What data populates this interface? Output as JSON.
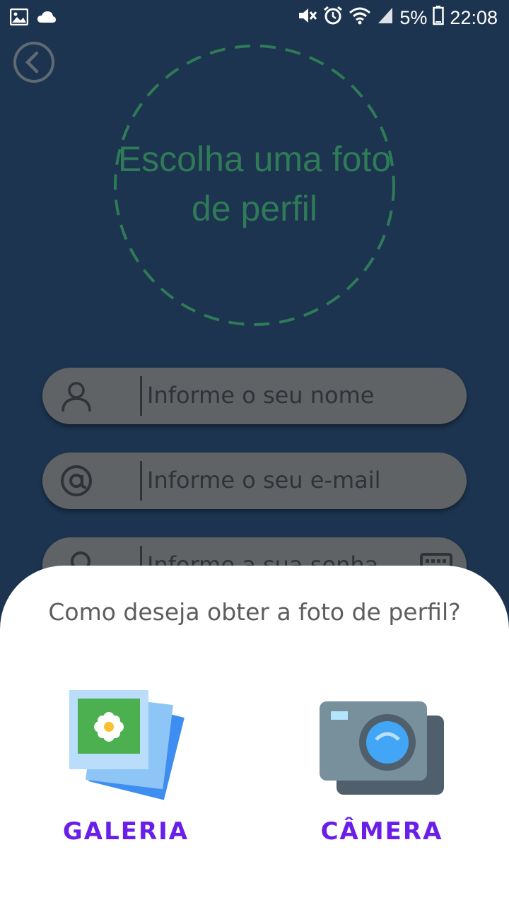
{
  "status_bar": {
    "left_icons": [
      "image-icon",
      "cloud-icon"
    ],
    "right_icons": [
      "mute-icon",
      "alarm-icon",
      "wifi-icon",
      "signal-icon"
    ],
    "battery": "5%",
    "time": "22:08"
  },
  "profile_photo": {
    "label": "Escolha uma foto de perfil"
  },
  "form": {
    "name_placeholder": "Informe o seu nome",
    "email_placeholder": "Informe o seu e-mail",
    "password_placeholder": "Informe a sua senha"
  },
  "sheet": {
    "title": "Como deseja obter a foto de perfil?",
    "options": [
      {
        "label": "GALERIA",
        "icon": "gallery-icon"
      },
      {
        "label": "CÂMERA",
        "icon": "camera-icon"
      }
    ]
  },
  "colors": {
    "background": "#1c344f",
    "field": "#5f6366",
    "accent_green": "#2f7a57",
    "option_label": "#6a1ee8"
  }
}
